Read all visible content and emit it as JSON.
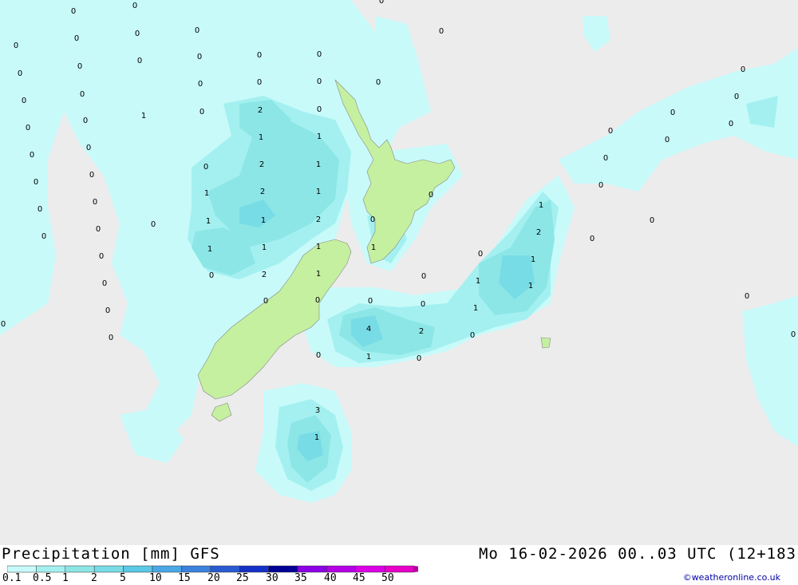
{
  "title": "Precipitation [mm] GFS",
  "datetime": "Mo 16-02-2026 00..03 UTC (12+183",
  "credit": "©weatheronline.co.uk",
  "legend": {
    "labels": [
      "0.1",
      "0.5",
      "1",
      "2",
      "5",
      "10",
      "15",
      "20",
      "25",
      "30",
      "35",
      "40",
      "45",
      "50"
    ],
    "colors": [
      "#c8fafa",
      "#a4f0f0",
      "#8ce6e6",
      "#78dce6",
      "#5ac8e6",
      "#4aa8e6",
      "#3a82dc",
      "#2a5ad2",
      "#1432c8",
      "#000096",
      "#8c00e6",
      "#b400e6",
      "#dc00e6",
      "#e600c8",
      "#b4009c"
    ]
  },
  "colors": {
    "land": "#c5f0a0",
    "sea": "#ececec",
    "light_precip": "#c8fafa"
  },
  "map_values": [
    "0",
    "0",
    "0",
    "0",
    "0",
    "0",
    "0",
    "0",
    "0",
    "0",
    "0",
    "0",
    "0",
    "0",
    "0",
    "0",
    "0",
    "0",
    "0",
    "0",
    "0",
    "0",
    "0",
    "0",
    "0",
    "0",
    "0",
    "0",
    "0",
    "0",
    "0",
    "0",
    "0",
    "0",
    "0",
    "0",
    "0",
    "0",
    "0",
    "0",
    "0",
    "0",
    "0",
    "0",
    "0",
    "0",
    "0",
    "0",
    "0",
    "0",
    "0",
    "0",
    "0",
    "0",
    "0",
    "0",
    "0",
    "0",
    "0",
    "0",
    "0",
    "0",
    "0",
    "1",
    "2",
    "1",
    "1",
    "2",
    "1",
    "1",
    "2",
    "1",
    "1",
    "1",
    "2",
    "1",
    "1",
    "1",
    "1",
    "2",
    "1",
    "1",
    "2",
    "1",
    "1",
    "1",
    "1",
    "4",
    "2",
    "1",
    "3",
    "1"
  ]
}
